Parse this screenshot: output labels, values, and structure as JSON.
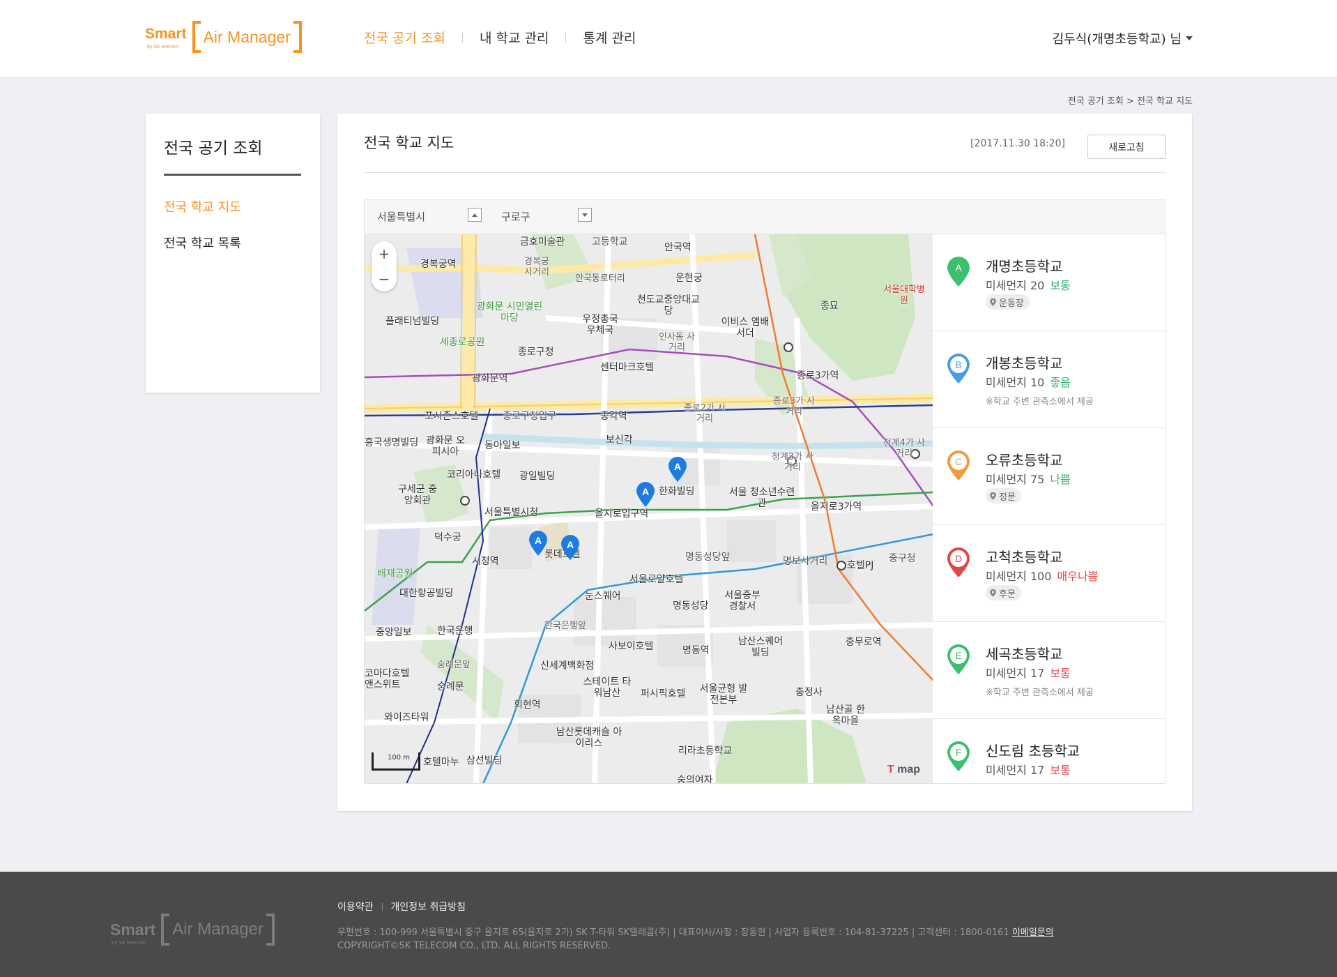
{
  "header": {
    "logo": {
      "smart": "Smart",
      "by": "by SK telecom",
      "name": "Air Manager"
    },
    "nav": [
      "전국 공기 조회",
      "내 학교 관리",
      "통계 관리"
    ],
    "user": "김두식(개명초등학교) 님"
  },
  "breadcrumb": "전국 공기 조회 > 전국 학교 지도",
  "sidebar": {
    "title": "전국 공기 조회",
    "items": [
      "전국 학교 지도",
      "전국 학교 목록"
    ]
  },
  "main": {
    "title": "전국 학교 지도",
    "timestamp": "[2017.11.30 18:20]",
    "refresh_label": "새로고침",
    "filter": {
      "city": "서울특별시",
      "district": "구로구"
    }
  },
  "map": {
    "zoom_in": "+",
    "zoom_out": "−",
    "scale": "100 m",
    "brand": "map",
    "pin_letter": "A",
    "labels": [
      "금호미술관",
      "고등학교",
      "안국역",
      "경복궁역",
      "경복궁 사거리",
      "안국동로터리",
      "운현궁",
      "광화문 시민열린마당",
      "플래티넘빌딩",
      "우정총국 우체국",
      "천도교중앙대교당",
      "이비스 앰배서더",
      "종묘",
      "세종로공원",
      "종로구청",
      "인사동 사거리",
      "센터마크호텔",
      "광화문역",
      "종로3가역",
      "포시즌스호텔",
      "종로구청입구",
      "종각역",
      "종로2가 사거리",
      "종로3가 사거리",
      "흥국생명빌딩",
      "광화문 오피시아",
      "동아일보",
      "보신각",
      "청계3가 사거리",
      "청계4가 사거리",
      "코리아나호텔",
      "광일빌딩",
      "한화빌딩",
      "구세군 중앙회관",
      "서울특별시청",
      "을지로입구역",
      "서울 청소년수련관",
      "을지로3가역",
      "덕수궁",
      "시청역",
      "롯데호텔",
      "명동성당앞",
      "명보사거리",
      "호텔PJ",
      "중구청",
      "배재공원",
      "서울로얄호텔",
      "대한항공빌딩",
      "눈스퀘어",
      "명동성당",
      "서울중부 경찰서",
      "중앙일보",
      "한국은행",
      "한국은행앞",
      "사보이호텔",
      "남산스퀘어빌딩",
      "충무로역",
      "숭례문앞",
      "신세계백화점",
      "명동역",
      "코마다호텔 앤스위트",
      "숭례문",
      "스테이트 타워남산",
      "퍼시픽호텔",
      "서울균형 발전본부",
      "충정사",
      "남산골 한옥마을",
      "회현역",
      "와이즈타워",
      "남산롯데캐슬 아이리스",
      "리라초등학교",
      "호텔마누",
      "삼선빌딩",
      "숭의여자",
      "서울대학병원"
    ]
  },
  "schools": [
    {
      "letter": "A",
      "name": "개명초등학교",
      "pm_label": "미세먼지 20",
      "status": "보통",
      "status_color": "#35b56a",
      "badge_color": "#3cc06f",
      "filled": true,
      "tag": "운동장",
      "note": ""
    },
    {
      "letter": "B",
      "name": "개봉초등학교",
      "pm_label": "미세먼지 10",
      "status": "좋음",
      "status_color": "#35b56a",
      "badge_color": "#4a9be8",
      "filled": false,
      "tag": "",
      "note": "※학교 주변 관측소에서 제공"
    },
    {
      "letter": "C",
      "name": "오류초등학교",
      "pm_label": "미세먼지 75",
      "status": "나쁨",
      "status_color": "#35b56a",
      "badge_color": "#f39a3a",
      "filled": false,
      "tag": "정문",
      "note": ""
    },
    {
      "letter": "D",
      "name": "고척초등학교",
      "pm_label": "미세먼지 100",
      "status": "매우나쁨",
      "status_color": "#e04848",
      "badge_color": "#e04848",
      "filled": false,
      "tag": "후문",
      "note": ""
    },
    {
      "letter": "E",
      "name": "세곡초등학교",
      "pm_label": "미세먼지 17",
      "status": "보통",
      "status_color": "#e04848",
      "badge_color": "#3cc06f",
      "filled": false,
      "tag": "",
      "note": "※학교 주변 관측소에서 제공"
    },
    {
      "letter": "F",
      "name": "신도림 초등학교",
      "pm_label": "미세먼지 17",
      "status": "보통",
      "status_color": "#e04848",
      "badge_color": "#3cc06f",
      "filled": false,
      "tag": "",
      "note": ""
    }
  ],
  "footer": {
    "links": [
      "이용약관",
      "개인정보 취급방침"
    ],
    "info": "우편번호 : 100-999 서울특별시 중구 을지로 65(을지로 2가) SK T-타워 SK텔레콤(주) | 대표이사/사장 : 장동현 | 사업자 등록번호 : 104-81-37225 | 고객센터 : 1800-0161",
    "email_link": "이메일문의",
    "copyright": "COPYRIGHT©SK TELECOM CO., LTD. ALL RIGHTS RESERVED."
  },
  "colors": {
    "accent": "#f7931e",
    "pin": "#1e7be0"
  }
}
